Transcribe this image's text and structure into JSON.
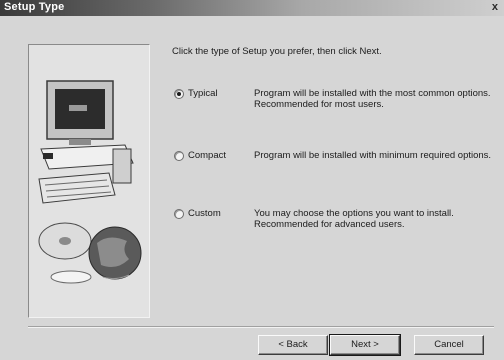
{
  "window": {
    "title": "Setup Type",
    "close_glyph": "x"
  },
  "instruction": "Click the type of Setup you prefer, then click Next.",
  "options": [
    {
      "label": "Typical",
      "description": "Program will be installed with the most common options.  Recommended for most users.",
      "selected": true
    },
    {
      "label": "Compact",
      "description": "Program will be installed with minimum required options.",
      "selected": false
    },
    {
      "label": "Custom",
      "description": "You may choose the options you want to install. Recommended for advanced users.",
      "selected": false
    }
  ],
  "buttons": {
    "back": "< Back",
    "next": "Next >",
    "cancel": "Cancel"
  },
  "illustration": {
    "icons": [
      "monitor-icon",
      "computer-case-icon",
      "keyboard-icon",
      "cd-disc-icon",
      "globe-icon"
    ]
  },
  "colors": {
    "dialog_face": "#d6d6d6",
    "title_bar_dark": "#3a3a3a",
    "title_bar_light": "#cfcfcf"
  }
}
